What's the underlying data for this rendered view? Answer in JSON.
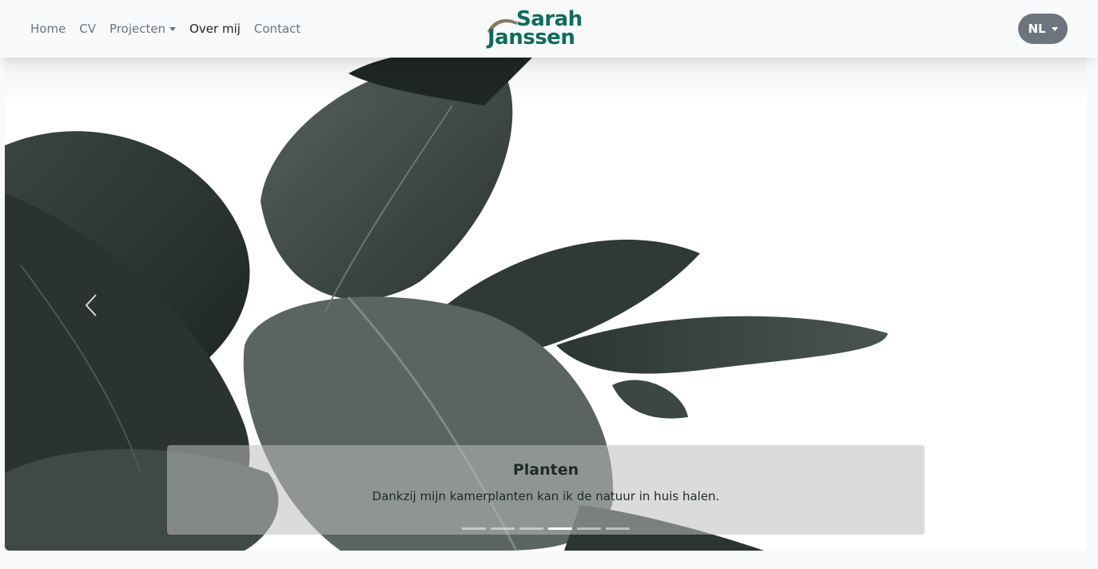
{
  "navbar": {
    "links": [
      {
        "label": "Home"
      },
      {
        "label": "CV"
      },
      {
        "label": "Projecten",
        "dropdown": true
      },
      {
        "label": "Over mij",
        "active": true
      },
      {
        "label": "Contact"
      }
    ],
    "brand": {
      "line1": "Sarah",
      "line2": "Janssen",
      "color": "#0f6b5c"
    },
    "language": {
      "label": "NL"
    }
  },
  "carousel": {
    "caption": {
      "title": "Planten",
      "text": "Dankzij mijn kamerplanten kan ik de natuur in huis halen."
    },
    "slide_count": 6,
    "active_index": 3,
    "image_icon": "rubber-plant-leaves"
  }
}
